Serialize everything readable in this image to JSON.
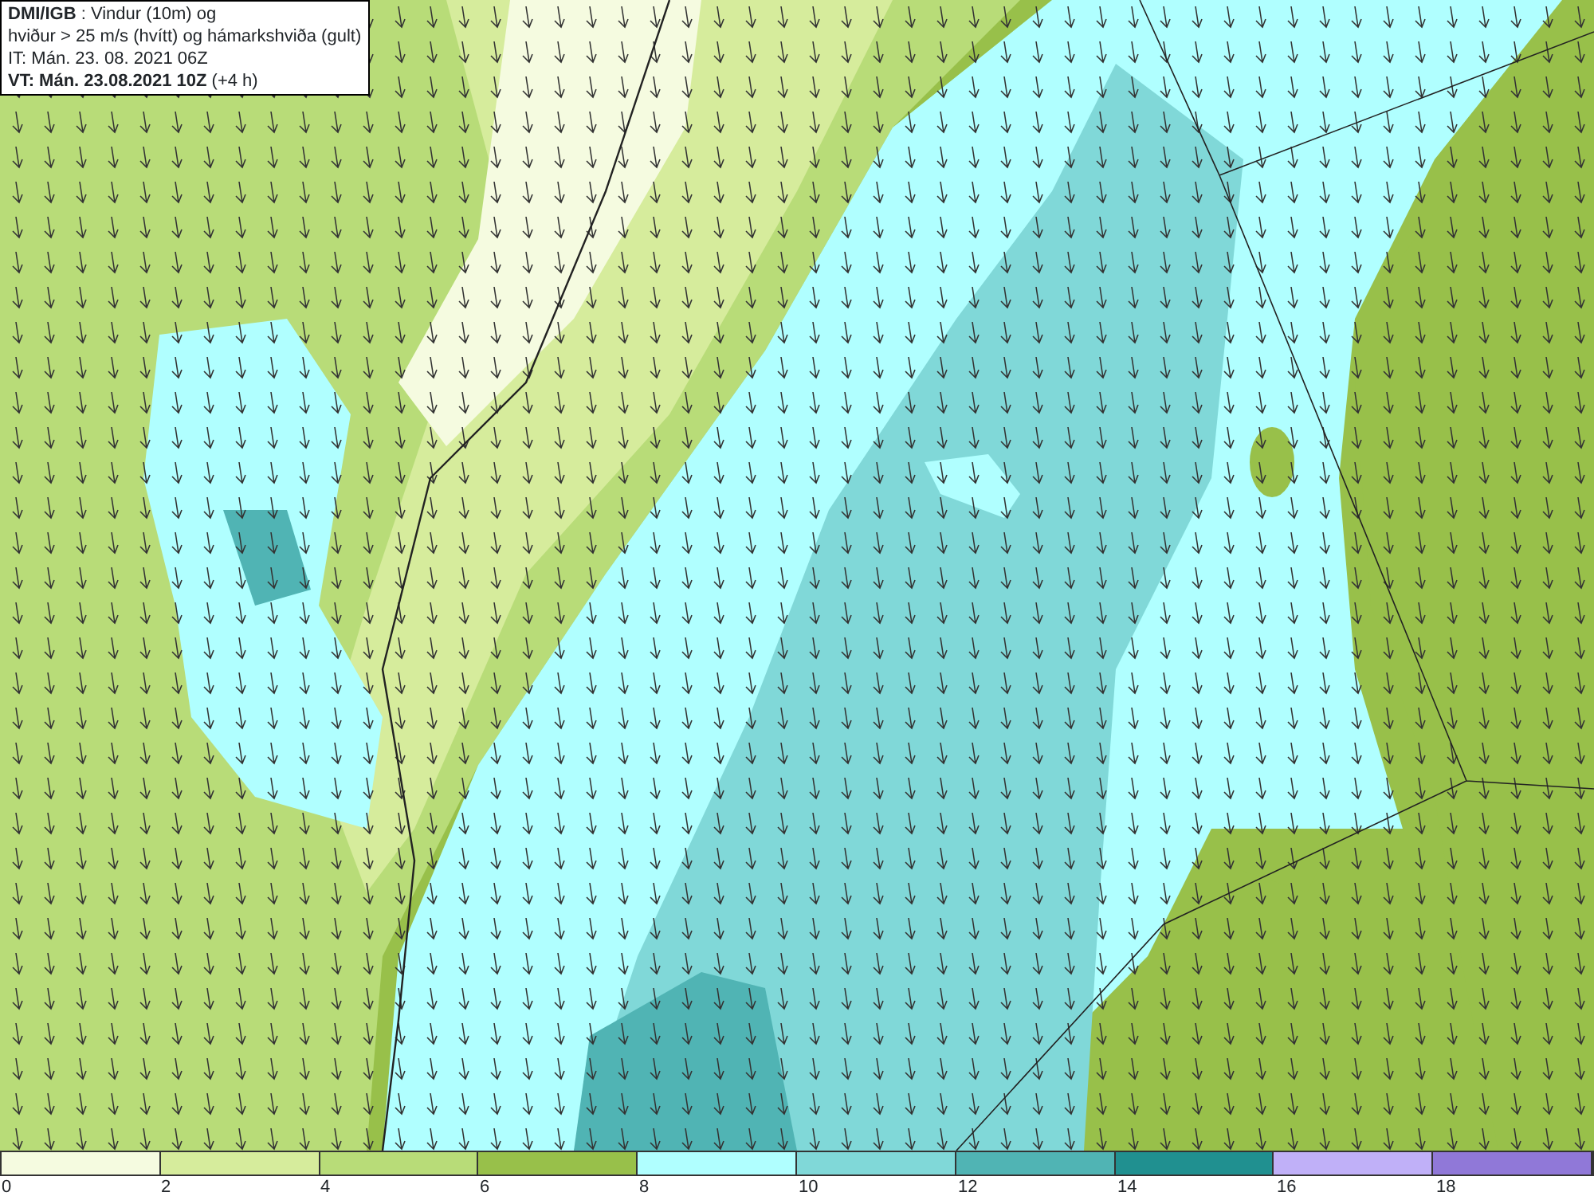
{
  "header": {
    "lines": [
      "**DMI/IGB** : Vindur (10m) og",
      "hviður > 25 m/s (hvítt) og hámarkshviða (gult)",
      "IT: Mán. 23. 08. 2021 06Z",
      "**VT: Mán. 23.08.2021 10Z** (+4 h)"
    ]
  },
  "legend": [
    {
      "color": "#f5fbe0",
      "label": "0"
    },
    {
      "color": "#d6ec9c",
      "label": "2"
    },
    {
      "color": "#b8dc78",
      "label": "4"
    },
    {
      "color": "#98c04a",
      "label": "6"
    },
    {
      "color": "#b0ffff",
      "label": "8"
    },
    {
      "color": "#80d8d8",
      "label": "10"
    },
    {
      "color": "#50b4b4",
      "label": "12"
    },
    {
      "color": "#209090",
      "label": "14"
    },
    {
      "color": "#c0b0f8",
      "label": "16"
    },
    {
      "color": "#9078d8",
      "label": "18"
    }
  ]
}
